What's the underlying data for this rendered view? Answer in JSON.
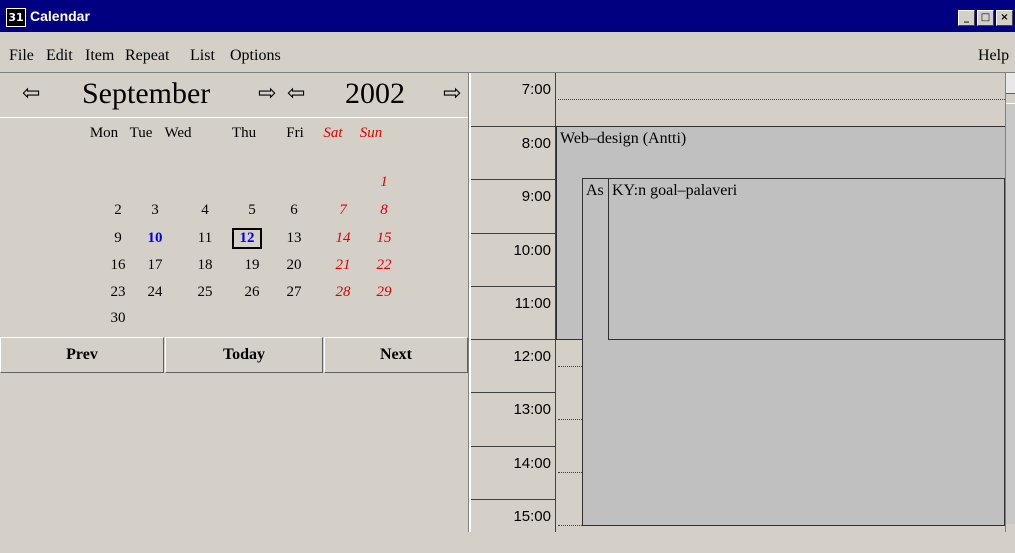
{
  "window": {
    "title": "Calendar",
    "icon": "calendar-app-icon",
    "controls": [
      "minimize",
      "maximize",
      "close"
    ]
  },
  "menu": {
    "items": [
      "File",
      "Edit",
      "Item",
      "Repeat",
      "List",
      "Options"
    ],
    "help": "Help"
  },
  "nav": {
    "month": "September",
    "year": "2002",
    "prev_month_icon": "left-arrow-icon",
    "next_month_icon": "right-arrow-icon"
  },
  "calendar": {
    "weekdays": [
      "Mon",
      "Tue",
      "Wed",
      "Thu",
      "Fri",
      "Sat",
      "Sun"
    ],
    "weeks": [
      [
        "",
        "",
        "",
        "",
        "",
        "",
        "1"
      ],
      [
        "2",
        "3",
        "4",
        "5",
        "6",
        "7",
        "8"
      ],
      [
        "9",
        "10",
        "11",
        "12",
        "13",
        "14",
        "15"
      ],
      [
        "16",
        "17",
        "18",
        "19",
        "20",
        "21",
        "22"
      ],
      [
        "23",
        "24",
        "25",
        "26",
        "27",
        "28",
        "29"
      ],
      [
        "30",
        "",
        "",
        "",
        "",
        "",
        ""
      ]
    ],
    "highlighted_day": "10",
    "selected_day": "12"
  },
  "buttons": {
    "prev": "Prev",
    "today": "Today",
    "next": "Next"
  },
  "schedule": {
    "times": [
      "7:00",
      "8:00",
      "9:00",
      "10:00",
      "11:00",
      "12:00",
      "13:00",
      "14:00",
      "15:00"
    ],
    "events": [
      {
        "label": "Web–design (Antti)",
        "start": "8:00",
        "end": "12:00"
      },
      {
        "label": "As",
        "start": "9:00",
        "end": "15:00+"
      },
      {
        "label": "KY:n goal–palaveri",
        "start": "9:00",
        "end": "12:00"
      }
    ]
  },
  "colors": {
    "titlebar": "#000080",
    "weekend": "#e00000",
    "highlight": "#0000e0",
    "background": "#d4d0c8"
  }
}
